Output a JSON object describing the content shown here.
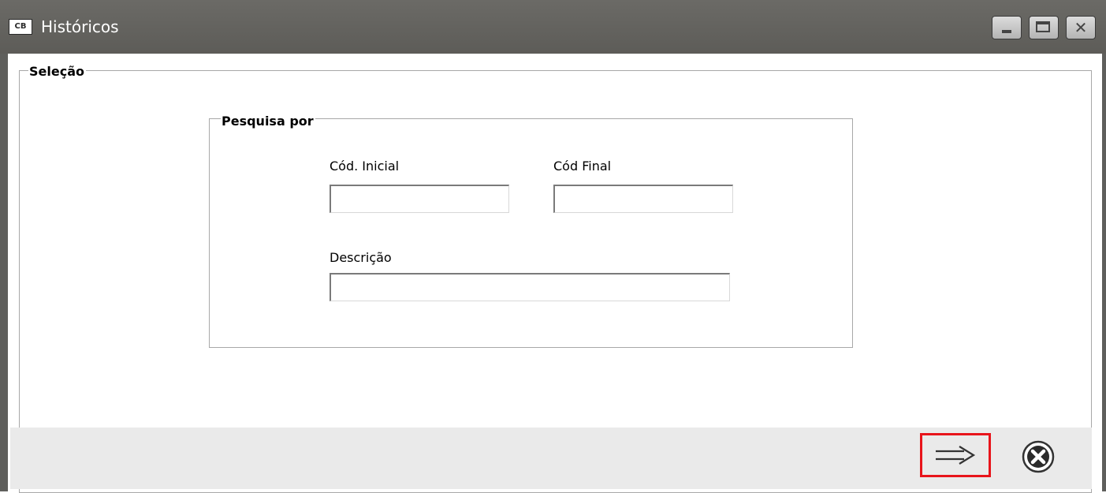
{
  "window": {
    "title": "Históricos",
    "app_icon_text": "CB",
    "controls": {
      "minimize": "minimize",
      "maximize": "maximize",
      "close": "✕"
    }
  },
  "selecao": {
    "legend": "Seleção",
    "pesquisa": {
      "legend": "Pesquisa por",
      "cod_inicial": {
        "label": "Cód. Inicial",
        "value": ""
      },
      "cod_final": {
        "label": "Cód Final",
        "value": ""
      },
      "descricao": {
        "label": "Descrição",
        "value": ""
      }
    }
  },
  "footer": {
    "ok_icon": "arrow-right-icon",
    "cancel_icon": "cancel-circle-icon",
    "highlight_color": "#e8141b"
  }
}
